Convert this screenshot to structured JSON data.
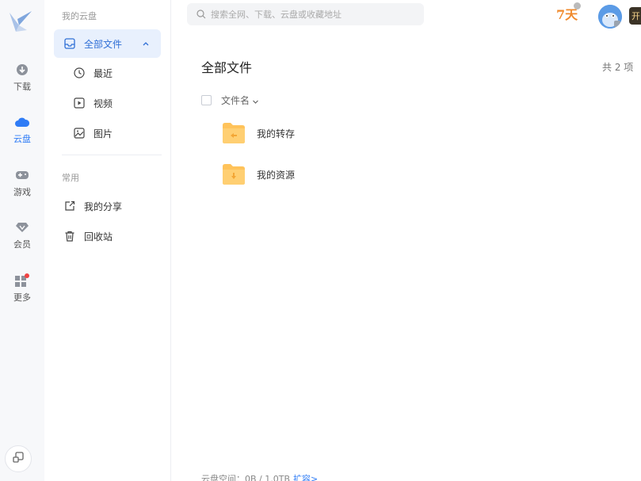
{
  "rail": {
    "items": [
      {
        "label": "下载",
        "icon": "download-icon"
      },
      {
        "label": "云盘",
        "icon": "cloud-icon"
      },
      {
        "label": "游戏",
        "icon": "gamepad-icon"
      },
      {
        "label": "会员",
        "icon": "diamond-icon"
      },
      {
        "label": "更多",
        "icon": "grid-icon"
      }
    ],
    "active": "云盘"
  },
  "sidebar": {
    "section_my_drive": "我的云盘",
    "all_files": "全部文件",
    "recent": "最近",
    "video": "视频",
    "images": "图片",
    "section_common": "常用",
    "my_share": "我的分享",
    "recycle_bin": "回收站"
  },
  "search": {
    "placeholder": "搜索全网、下载、云盘或收藏地址"
  },
  "header": {
    "sign_days": "7天",
    "open_label": "开"
  },
  "main": {
    "title": "全部文件",
    "item_count": "共 2 项 ",
    "column_name": "文件名",
    "files": [
      {
        "name": "我的转存",
        "icon": "folder-transfer-icon"
      },
      {
        "name": "我的资源",
        "icon": "folder-download-icon"
      }
    ]
  },
  "footer": {
    "storage_label": "云盘空间：0B / 1.0TB",
    "expand_label": "扩容>"
  },
  "colors": {
    "accent": "#2f7cf6",
    "folder": "#ffc35a",
    "sign_orange": "#f08a2c"
  }
}
